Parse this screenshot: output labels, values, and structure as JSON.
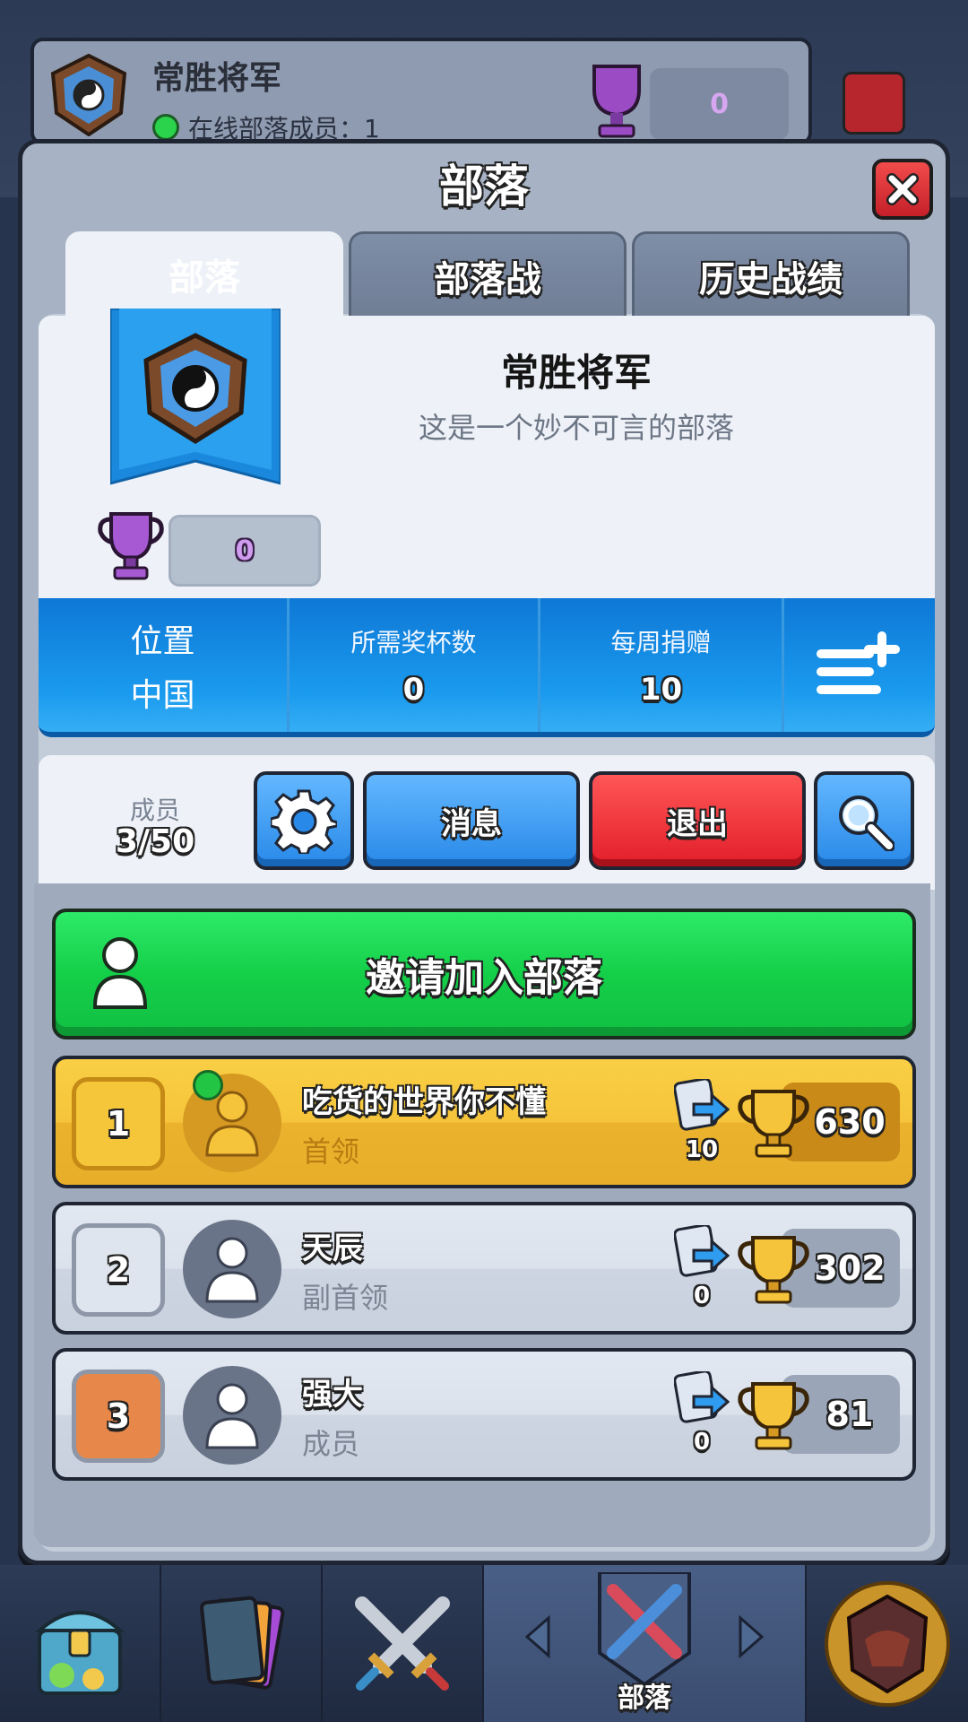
{
  "background": {
    "clan_name": "常胜将军",
    "online_text": "在线部落成员：1",
    "trophies": "0"
  },
  "modal": {
    "title": "部落",
    "tabs": [
      {
        "label": "部落",
        "active": true
      },
      {
        "label": "部落战",
        "active": false
      },
      {
        "label": "历史战绩",
        "active": false
      }
    ]
  },
  "clan": {
    "name": "常胜将军",
    "description": "这是一个妙不可言的部落",
    "trophies": "0",
    "stats": {
      "location_label": "位置",
      "location_value": "中国",
      "required_trophies_label": "所需奖杯数",
      "required_trophies_value": "0",
      "weekly_donations_label": "每周捐赠",
      "weekly_donations_value": "10"
    }
  },
  "members_bar": {
    "label": "成员",
    "count": "3/50",
    "message_label": "消息",
    "leave_label": "退出"
  },
  "invite": {
    "label": "邀请加入部落"
  },
  "members": [
    {
      "rank": "1",
      "name": "吃货的世界你不懂",
      "role": "首领",
      "donations": "10",
      "trophies": "630",
      "online": true
    },
    {
      "rank": "2",
      "name": "天辰",
      "role": "副首领",
      "donations": "0",
      "trophies": "302",
      "online": false
    },
    {
      "rank": "3",
      "name": "强大",
      "role": "成员",
      "donations": "0",
      "trophies": "81",
      "online": false
    }
  ],
  "bottom_nav": {
    "active_label": "部落",
    "items": [
      "shop-chest-icon",
      "cards-icon",
      "battle-swords-icon",
      "clan-shield-icon",
      "tournament-icon"
    ]
  },
  "colors": {
    "accent_blue": "#1a9aee",
    "green_button": "#14cf48",
    "red_button": "#e21e2a",
    "gold_row": "#f6c43a"
  }
}
